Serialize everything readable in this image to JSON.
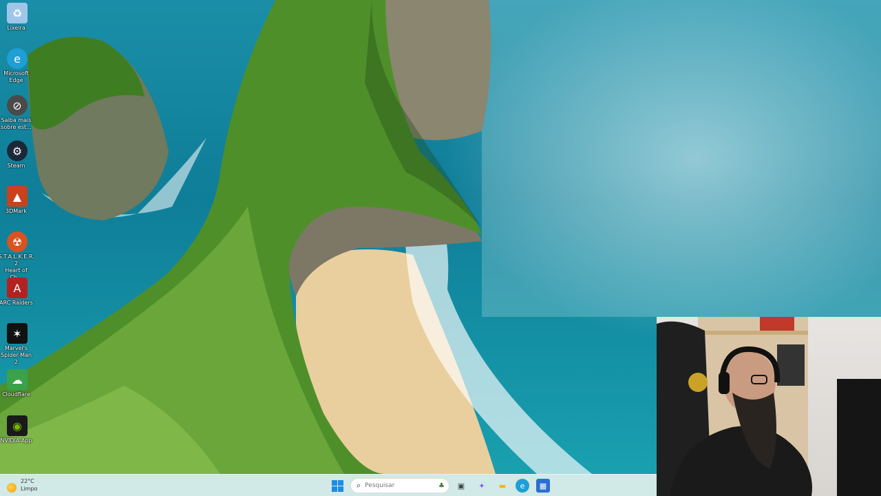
{
  "desktop_icons": [
    {
      "id": "recycle-bin",
      "label": "Lixeira",
      "icon": "recycle-bin-icon",
      "color": "#9fc6e8",
      "glyph": "♻"
    },
    {
      "id": "edge",
      "label": "Microsoft\nEdge",
      "icon": "edge-icon",
      "color": "#1e9fd6",
      "glyph": "e"
    },
    {
      "id": "learn-more",
      "label": "Saiba mais\nsobre est...",
      "icon": "learn-more-icon",
      "color": "#4a4a4a",
      "glyph": "⊘"
    },
    {
      "id": "steam",
      "label": "Steam",
      "icon": "steam-icon",
      "color": "#1b2838",
      "glyph": "⚙"
    },
    {
      "id": "3dmark",
      "label": "3DMark",
      "icon": "3dmark-icon",
      "color": "#c8421b",
      "glyph": "▲"
    },
    {
      "id": "stalker",
      "label": "S.T.A.L.K.E.R. 2\nHeart of Ch...",
      "icon": "stalker-icon",
      "color": "#d9531e",
      "glyph": "☢"
    },
    {
      "id": "arc-raiders",
      "label": "ARC Raiders",
      "icon": "arc-raiders-icon",
      "color": "#b22222",
      "glyph": "A"
    },
    {
      "id": "spider-man",
      "label": "Marvel's\nSpider-Man 2",
      "icon": "spider-man-icon",
      "color": "#111111",
      "glyph": "✶"
    },
    {
      "id": "app-green",
      "label": "Cloudflare",
      "icon": "app-icon",
      "color": "#3aa24a",
      "glyph": "☁"
    },
    {
      "id": "nvidia",
      "label": "NVIDIA App",
      "icon": "nvidia-icon",
      "color": "#1a1a1a",
      "glyph": "◉"
    }
  ],
  "taskbar": {
    "weather": {
      "temp": "22°C",
      "condition": "Limpo"
    },
    "search_placeholder": "Pesquisar",
    "apps": [
      {
        "id": "task-view",
        "icon": "task-view-icon",
        "color": "#444444",
        "glyph": "▣"
      },
      {
        "id": "copilot",
        "icon": "copilot-icon",
        "color": "#7a5af8",
        "glyph": "✦"
      },
      {
        "id": "file-explorer",
        "icon": "folder-icon",
        "color": "#f2b705",
        "glyph": "▬"
      },
      {
        "id": "edge",
        "icon": "edge-icon",
        "color": "#1e9fd6",
        "glyph": "e"
      },
      {
        "id": "store",
        "icon": "store-icon",
        "color": "#2b6fd1",
        "glyph": "▦"
      }
    ]
  },
  "colors": {
    "accent": "#1e8ce6",
    "sea": "#0f7e98",
    "cliff_green": "#4f8f2a",
    "sand": "#e9cf9e"
  }
}
